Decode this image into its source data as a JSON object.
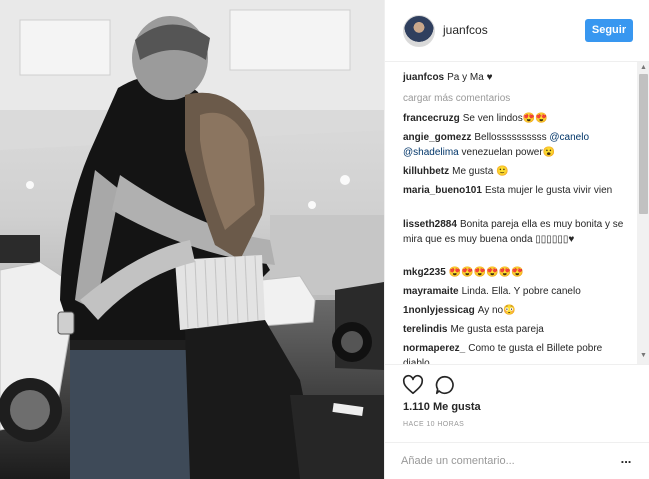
{
  "post": {
    "username": "juanfcos",
    "follow_label": "Seguir",
    "caption_user": "juanfcos",
    "caption_text": "Pa y Ma ♥",
    "load_more": "cargar más comentarios",
    "comments": [
      {
        "user": "francecruzg",
        "text": "Se ven lindos😍😍"
      },
      {
        "user": "angie_gomezz",
        "text": "Bellossssssssss",
        "mention1": "@canelo",
        "mention2": "@shadelima",
        "text2": "venezuelan power😮"
      },
      {
        "user": "killuhbetz",
        "text": "Me gusta 🙂"
      },
      {
        "user": "maria_bueno101",
        "text": "Esta mujer le gusta vivir vien"
      },
      {
        "user": "lisseth2884",
        "text": "Bonita pareja ella es muy bonita y se mira que es muy buena onda ▯▯▯▯▯▯♥"
      },
      {
        "user": "mkg2235",
        "text": "😍😍😍😍😍😍"
      },
      {
        "user": "mayramaite",
        "text": "Linda. Ella. Y pobre canelo"
      },
      {
        "user": "1nonlyjessicag",
        "text": "Ay no😳"
      },
      {
        "user": "terelindis",
        "text": "Me gusta esta pareja"
      },
      {
        "user": "normaperez_",
        "text": "Como te gusta el Billete pobre diablo"
      }
    ],
    "likes": "1.110 Me gusta",
    "time": "HACE 10 HORAS",
    "comment_placeholder": "Añade un comentario...",
    "more_label": "...",
    "icons": [
      "heart-icon",
      "comment-bubble-icon",
      "more-options-icon"
    ],
    "colors": {
      "follow_button": "#3897f0",
      "mention": "#003569",
      "muted": "#999999"
    }
  }
}
